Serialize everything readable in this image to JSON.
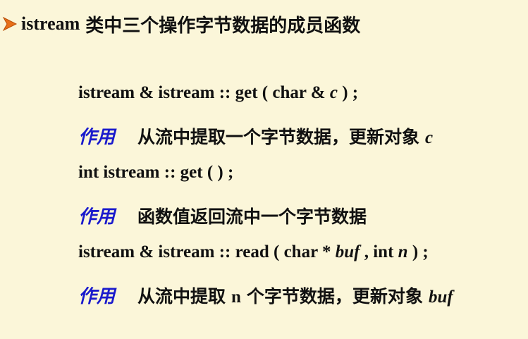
{
  "heading": {
    "latin": "istream",
    "cjk": "类中三个操作字节数据的成员函数"
  },
  "items": [
    {
      "code_parts": [
        "istream & istream :: get ( char & ",
        "c",
        " ) ;"
      ],
      "tag": "作用",
      "desc": "从流中提取一个字节数据，更新对象",
      "desc_var": "c"
    },
    {
      "code_parts": [
        "int  istream :: get ( ) ;"
      ],
      "tag": "作用",
      "desc": "函数值返回流中一个字节数据"
    },
    {
      "code_parts": [
        "istream & istream :: read ( char * ",
        "buf",
        " ,  int  ",
        "n",
        " ) ;"
      ],
      "tag": "作用",
      "desc_pre": "从流中提取",
      "desc_mid": "n",
      "desc_post": "个字节数据，更新对象",
      "desc_var": "buf"
    }
  ],
  "colors": {
    "background": "#FBF6D9",
    "bullet": "#E8701A",
    "tag": "#1a1acc"
  },
  "icons": {
    "bullet": "orange-triangle-bullet-icon"
  }
}
